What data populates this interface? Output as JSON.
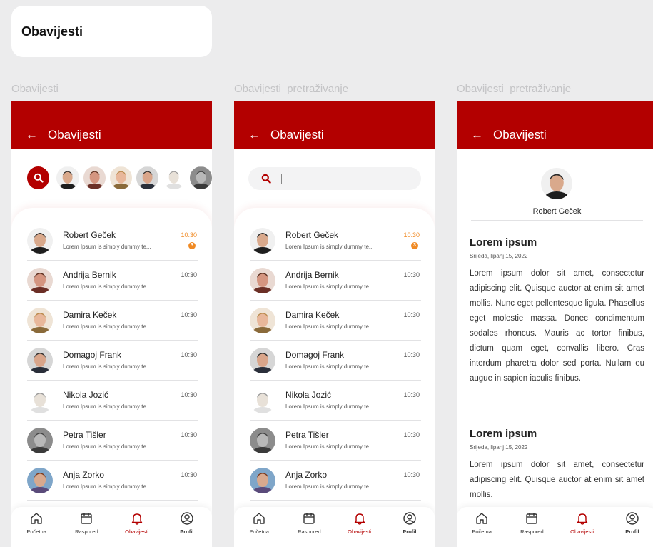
{
  "page_title": "Obavijesti",
  "frames": [
    {
      "label": "Obavijesti"
    },
    {
      "label": "Obavijesti_pretraživanje"
    },
    {
      "label": "Obavijesti_pretraživanje"
    }
  ],
  "appbar": {
    "back_icon": "←",
    "title": "Obavijesti"
  },
  "colors": {
    "brand": "#b30000",
    "unread": "#f08a24"
  },
  "contacts": [
    {
      "name": "Robert Geček",
      "message": "Lorem Ipsum is simply dummy te...",
      "time": "10:30",
      "unread": true,
      "badge": "3",
      "skin": "#d9a98c",
      "hair": "#2b2b2b",
      "bg": "#f0f0f0",
      "shirt": "#1e1e1e"
    },
    {
      "name": "Andrija Bernik",
      "message": "Lorem Ipsum is simply dummy te...",
      "time": "10:30",
      "unread": false,
      "badge": "",
      "skin": "#d49580",
      "hair": "#5a2f1f",
      "bg": "#e9d9d2",
      "shirt": "#6b2f26"
    },
    {
      "name": "Damira Keček",
      "message": "Lorem Ipsum is simply dummy te...",
      "time": "10:30",
      "unread": false,
      "badge": "",
      "skin": "#e8b79a",
      "hair": "#b98a4c",
      "bg": "#efe4d6",
      "shirt": "#8a6a3a"
    },
    {
      "name": "Domagoj Frank",
      "message": "Lorem Ipsum is simply dummy te...",
      "time": "10:30",
      "unread": false,
      "badge": "",
      "skin": "#d9a58a",
      "hair": "#2e2e2e",
      "bg": "#d6d6d6",
      "shirt": "#2a2f3a"
    },
    {
      "name": "Nikola Jozić",
      "message": "Lorem Ipsum is simply dummy te...",
      "time": "10:30",
      "unread": false,
      "badge": "",
      "skin": "#e8e1d8",
      "hair": "#9a9a9a",
      "bg": "#ffffff",
      "shirt": "#e0e0e0"
    },
    {
      "name": "Petra Tišler",
      "message": "Lorem Ipsum is simply dummy te...",
      "time": "10:30",
      "unread": false,
      "badge": "",
      "skin": "#b8b8b8",
      "hair": "#444444",
      "bg": "#8c8c8c",
      "shirt": "#3a3a3a"
    },
    {
      "name": "Anja Zorko",
      "message": "Lorem Ipsum is simply dummy te...",
      "time": "10:30",
      "unread": false,
      "badge": "",
      "skin": "#d8a98e",
      "hair": "#7a3a1e",
      "bg": "#7fa6c9",
      "shirt": "#5a4a7a"
    }
  ],
  "search": {
    "icon": "search-icon",
    "value": ""
  },
  "nav": [
    {
      "label": "Početna",
      "icon": "home-icon",
      "active": false
    },
    {
      "label": "Raspored",
      "icon": "calendar-icon",
      "active": false
    },
    {
      "label": "Obavijesti",
      "icon": "bell-icon",
      "active": true
    },
    {
      "label": "Profil",
      "icon": "profile-icon",
      "active": false
    }
  ],
  "detail": {
    "sender": "Robert Geček",
    "articles": [
      {
        "title": "Lorem ipsum",
        "date": "Srijeda, lipanj 15, 2022",
        "body": "Lorem ipsum dolor sit amet, consectetur adipiscing elit. Quisque auctor at enim sit amet mollis. Nunc eget pellentesque ligula. Phasellus eget molestie massa. Donec condimentum sodales rhoncus. Mauris ac tortor finibus, dictum quam eget, convallis libero. Cras interdum pharetra dolor sed porta. Nullam eu augue in sapien iaculis finibus."
      },
      {
        "title": "Lorem ipsum",
        "date": "Srijeda, lipanj 15, 2022",
        "body": "Lorem ipsum dolor sit amet, consectetur adipiscing elit. Quisque auctor at enim sit amet mollis."
      }
    ]
  }
}
